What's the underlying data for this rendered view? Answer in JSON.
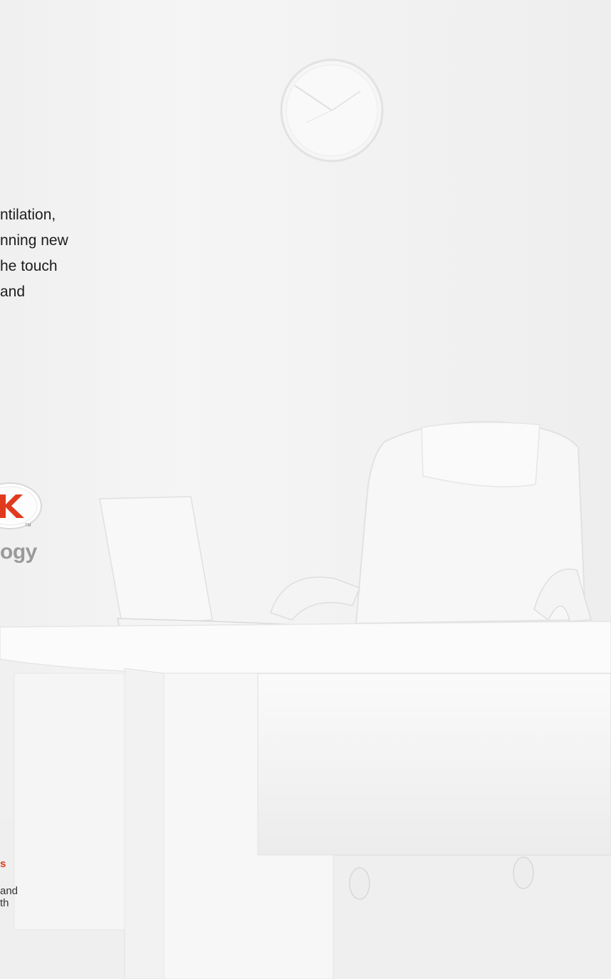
{
  "intro": {
    "lines": [
      "ntilation,",
      "nning new",
      "he touch",
      "and"
    ]
  },
  "brand": {
    "tm": "TM",
    "tagline": "ogy",
    "accent_color": "#e03a1e"
  },
  "feature": {
    "title": "s",
    "lines": [
      "and",
      "th"
    ]
  },
  "background": {
    "description_icon": "white-office-photo"
  }
}
